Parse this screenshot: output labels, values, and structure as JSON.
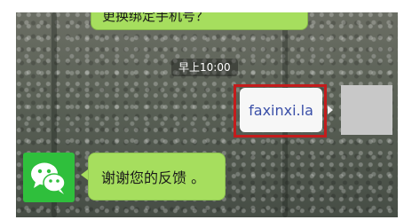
{
  "chat": {
    "top_message_partial": "更换绑定手机号？",
    "timestamp": "早上10:00",
    "sent_link": "faxinxi.la",
    "reply_message": "谢谢您的反馈 。"
  },
  "colors": {
    "incoming_bubble": "#a6de5e",
    "outgoing_bubble": "#f7f7f7",
    "highlight_border": "#c41c1c",
    "wechat_green": "#2fbf3c"
  },
  "icons": {
    "contact_avatar": "wechat-logo-icon",
    "self_avatar": "placeholder-avatar"
  }
}
